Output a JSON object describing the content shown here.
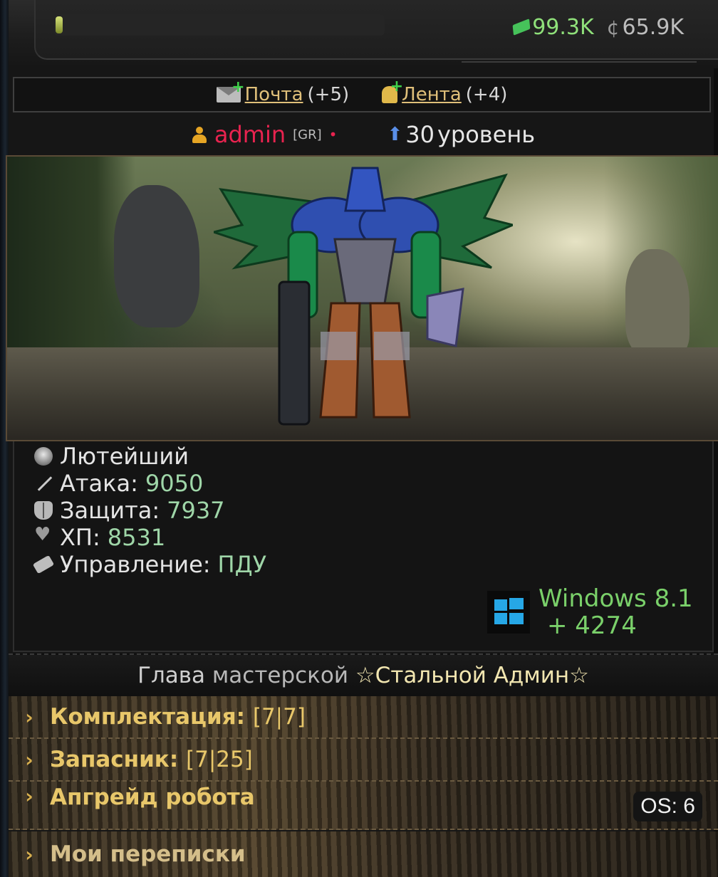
{
  "header": {
    "cash": "99.3K",
    "coins": "65.9K",
    "cash_icon": "cash-icon",
    "coin_icon": "coin-icon",
    "coin_symbol": "¢"
  },
  "notifications": {
    "mail_label": "Почта",
    "mail_count": "(+5)",
    "feed_label": "Лента",
    "feed_count": "(+4)"
  },
  "user": {
    "name": "admin",
    "clan_tag": "[GR]",
    "online_dot": "•",
    "level_number": "30",
    "level_text": "уровень"
  },
  "stats": {
    "rank": "Лютейший",
    "attack_label": "Атака:",
    "attack_value": "9050",
    "defense_label": "Защита:",
    "defense_value": "7937",
    "hp_label": "ХП:",
    "hp_value": "8531",
    "control_label": "Управление:",
    "control_value": "ПДУ"
  },
  "os": {
    "name": "Windows 8.1",
    "bonus": "+ 4274"
  },
  "workshop": {
    "prefix": "Глава",
    "middle": "мастерской",
    "name": "☆Стальной Админ☆"
  },
  "menu": [
    {
      "label": "Комплектация:",
      "count": "[7|7]"
    },
    {
      "label": "Запасник:",
      "count": "[7|25]"
    },
    {
      "label": "Апгрейд робота",
      "count": ""
    },
    {
      "label": "Мои переписки",
      "count": ""
    }
  ],
  "os_pill": "OS: 6",
  "colors": {
    "username": "#e8234f",
    "stat_value": "#9fd6a8",
    "os_text": "#7ad06a",
    "menu_text": "#e8c76a"
  }
}
